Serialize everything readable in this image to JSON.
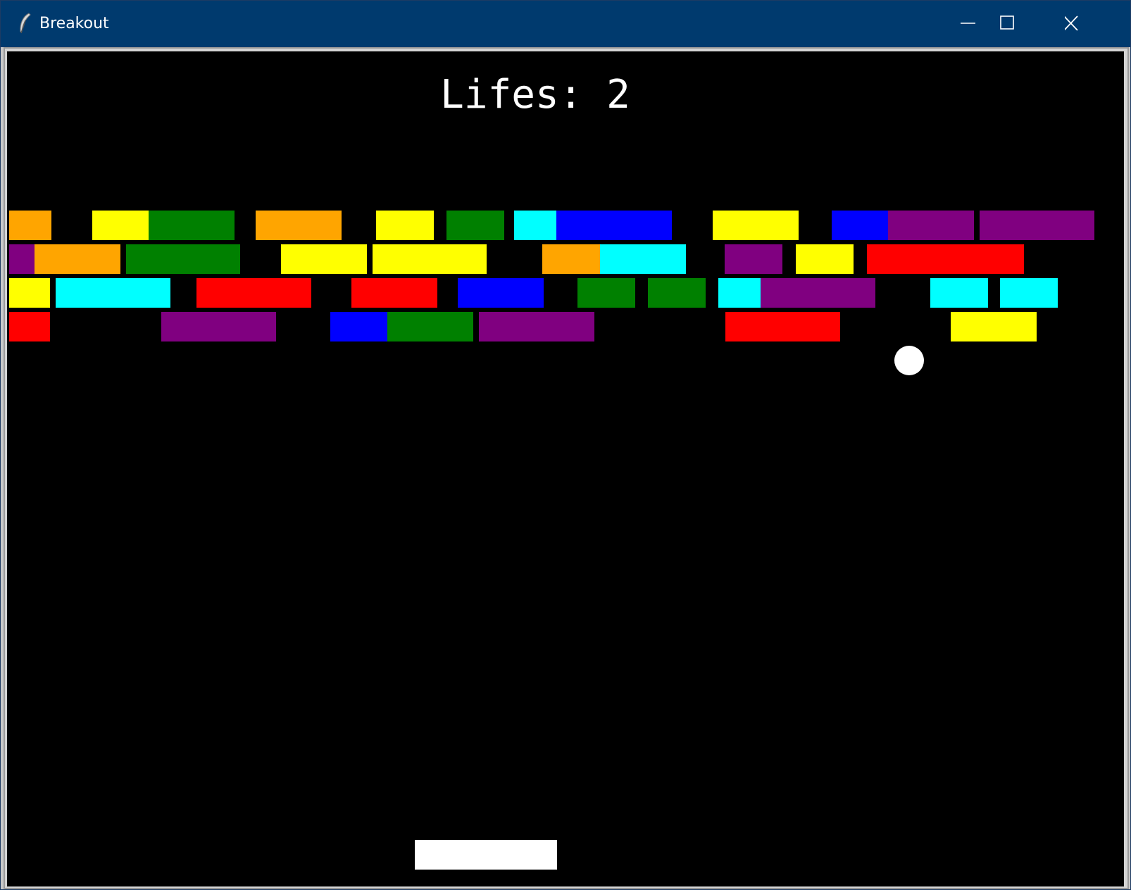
{
  "window": {
    "title": "Breakout",
    "icon": "feather-icon",
    "controls": [
      "minimize-icon",
      "maximize-icon",
      "close-icon"
    ],
    "titlebar_color": "#003a6e"
  },
  "game": {
    "hud_text": "Lifes: 2",
    "lives": 2,
    "background_color": "#000000",
    "ball_color": "#ffffff",
    "paddle_color": "#ffffff",
    "brick_colors": {
      "orange": "#ffa500",
      "yellow": "#ffff00",
      "green": "#008000",
      "cyan": "#00ffff",
      "blue": "#0000ff",
      "purple": "#800080",
      "red": "#ff0000"
    },
    "brick_rows": [
      [
        "orange",
        "yellow",
        "green",
        "orange",
        "yellow",
        "green",
        "cyan",
        "blue",
        "yellow",
        "blue",
        "purple",
        "purple"
      ],
      [
        "purple",
        "orange",
        "green",
        "yellow",
        "yellow",
        "orange",
        "cyan",
        "purple",
        "yellow",
        "red"
      ],
      [
        "yellow",
        "cyan",
        "red",
        "red",
        "blue",
        "green",
        "green",
        "cyan",
        "purple",
        "cyan",
        "cyan"
      ],
      [
        "red",
        "purple",
        "blue",
        "green",
        "purple",
        "red",
        "yellow"
      ]
    ]
  }
}
